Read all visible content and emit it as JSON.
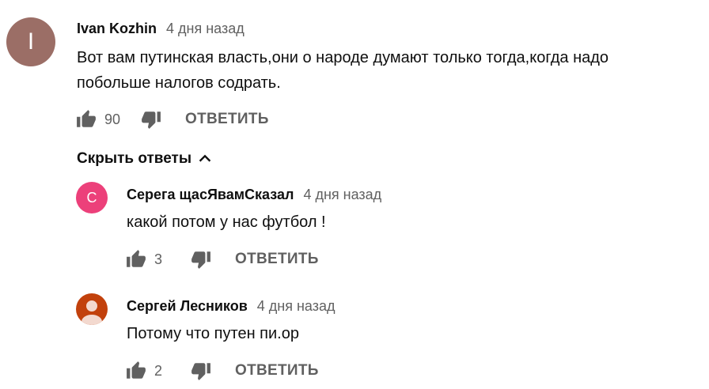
{
  "comments": {
    "main": {
      "avatar_letter": "I",
      "author": "Ivan Kozhin",
      "time": "4 дня назад",
      "text_line1": "Вот вам путинская власть,они о народе думают только тогда,когда надо",
      "text_line2": "побольше налогов содрать.",
      "likes": "90",
      "reply_label": "ОТВЕТИТЬ"
    },
    "hide_replies_label": "Скрыть ответы",
    "replies": [
      {
        "avatar_letter": "С",
        "avatar_color": "#ec407a",
        "author": "Серега щасЯвамСказал",
        "time": "4 дня назад",
        "text": "какой потом у нас футбол !",
        "likes": "3",
        "reply_label": "ОТВЕТИТЬ"
      },
      {
        "avatar_color": "#c2410c",
        "author": "Сергей Лесников",
        "time": "4 дня назад",
        "text": "Потому что путен пи.ор",
        "likes": "2",
        "reply_label": "ОТВЕТИТЬ"
      }
    ]
  },
  "colors": {
    "main_avatar": "#9b6e66",
    "meta_text": "#606060",
    "primary_text": "#0f0f0f"
  },
  "icons": [
    "thumb-up-icon",
    "thumb-down-icon",
    "chevron-up-icon",
    "person-icon"
  ]
}
